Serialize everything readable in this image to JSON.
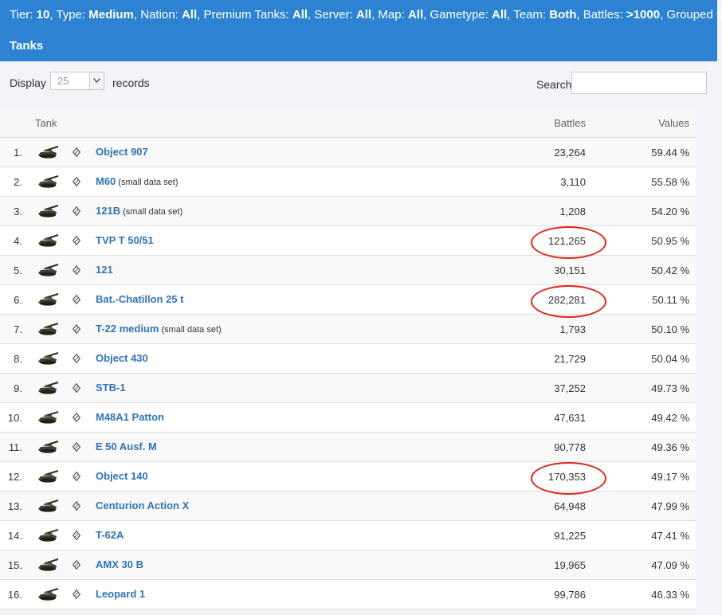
{
  "filter": {
    "line1": [
      {
        "label": "Tier: ",
        "value": "10"
      },
      {
        "label": ", Type: ",
        "value": "Medium"
      },
      {
        "label": ", Nation: ",
        "value": "All"
      },
      {
        "label": ", Premium Tanks: ",
        "value": "All"
      },
      {
        "label": ", Server: ",
        "value": "All"
      },
      {
        "label": ", Map: ",
        "value": "All"
      },
      {
        "label": ", Gametype: ",
        "value": "All"
      },
      {
        "label": ", Team: ",
        "value": "Both"
      },
      {
        "label": ", Battles: ",
        "value": ">1000"
      },
      {
        "label": ", Grouped by:",
        "value": ""
      }
    ],
    "line2": "Tanks"
  },
  "controls": {
    "display_label": "Display",
    "display_value": "25",
    "records_label": "records",
    "search_label": "Search:",
    "search_value": ""
  },
  "columns": {
    "tank": "Tank",
    "battles": "Battles",
    "values": "Values"
  },
  "rows": [
    {
      "rank": "1.",
      "name": "Object 907",
      "note": "",
      "battles": "23,264",
      "value": "59.44 %",
      "circled": false
    },
    {
      "rank": "2.",
      "name": "M60",
      "note": "(small data set)",
      "battles": "3,110",
      "value": "55.58 %",
      "circled": false
    },
    {
      "rank": "3.",
      "name": "121B",
      "note": "(small data set)",
      "battles": "1,208",
      "value": "54.20 %",
      "circled": false
    },
    {
      "rank": "4.",
      "name": "TVP T 50/51",
      "note": "",
      "battles": "121,265",
      "value": "50.95 %",
      "circled": true
    },
    {
      "rank": "5.",
      "name": "121",
      "note": "",
      "battles": "30,151",
      "value": "50.42 %",
      "circled": false
    },
    {
      "rank": "6.",
      "name": "Bat.-Chatillon 25 t",
      "note": "",
      "battles": "282,281",
      "value": "50.11 %",
      "circled": true
    },
    {
      "rank": "7.",
      "name": "T-22 medium",
      "note": "(small data set)",
      "battles": "1,793",
      "value": "50.10 %",
      "circled": false
    },
    {
      "rank": "8.",
      "name": "Object 430",
      "note": "",
      "battles": "21,729",
      "value": "50.04 %",
      "circled": false
    },
    {
      "rank": "9.",
      "name": "STB-1",
      "note": "",
      "battles": "37,252",
      "value": "49.73 %",
      "circled": false
    },
    {
      "rank": "10.",
      "name": "M48A1 Patton",
      "note": "",
      "battles": "47,631",
      "value": "49.42 %",
      "circled": false
    },
    {
      "rank": "11.",
      "name": "E 50 Ausf. M",
      "note": "",
      "battles": "90,778",
      "value": "49.36 %",
      "circled": false
    },
    {
      "rank": "12.",
      "name": "Object 140",
      "note": "",
      "battles": "170,353",
      "value": "49.17 %",
      "circled": true
    },
    {
      "rank": "13.",
      "name": "Centurion Action X",
      "note": "",
      "battles": "64,948",
      "value": "47.99 %",
      "circled": false
    },
    {
      "rank": "14.",
      "name": "T-62A",
      "note": "",
      "battles": "91,225",
      "value": "47.41 %",
      "circled": false
    },
    {
      "rank": "15.",
      "name": "AMX 30 B",
      "note": "",
      "battles": "19,965",
      "value": "47.09 %",
      "circled": false
    },
    {
      "rank": "16.",
      "name": "Leopard 1",
      "note": "",
      "battles": "99,786",
      "value": "46.33 %",
      "circled": false
    }
  ],
  "colors": {
    "header_bg": "#2d83d2",
    "link": "#2f74b8",
    "annotation": "#e0241b"
  },
  "icons": {
    "tank": "tank-icon",
    "nation": "nation-flag-icon",
    "dropdown": "chevron-down-icon"
  }
}
